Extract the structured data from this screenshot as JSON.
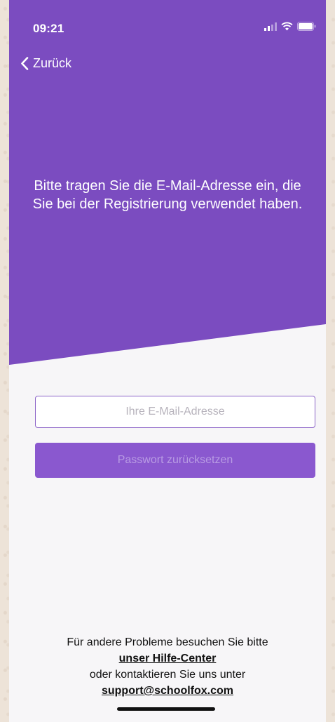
{
  "status_bar": {
    "time": "09:21",
    "icons": [
      "signal-icon",
      "wifi-icon",
      "battery-icon"
    ]
  },
  "nav": {
    "back_label": "Zurück"
  },
  "header": {
    "intro_text": "Bitte tragen Sie die E-Mail-Adresse ein, die Sie bei der Registrierung verwendet haben."
  },
  "form": {
    "email_value": "",
    "email_placeholder": "Ihre E-Mail-Adresse",
    "reset_button_label": "Passwort zurücksetzen"
  },
  "help": {
    "line1": "Für andere Probleme besuchen Sie bitte",
    "help_center_link": "unser Hilfe-Center",
    "line2": "oder kontaktieren Sie uns unter",
    "support_email": "support@schoolfox.com"
  },
  "colors": {
    "brand_purple": "#7b4cc0",
    "button_purple": "#8a58cf",
    "background": "#f7f6f8"
  }
}
